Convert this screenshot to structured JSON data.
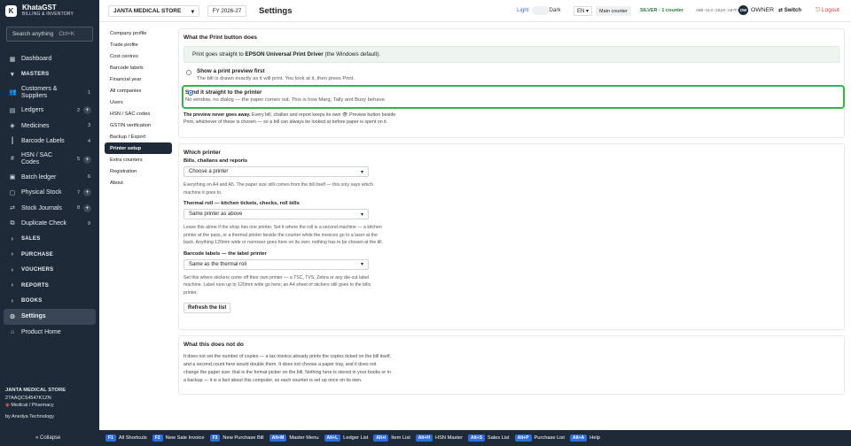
{
  "brand": {
    "logo": "K",
    "name": "KhataGST",
    "sub": "BILLING & INVENTORY"
  },
  "search": {
    "placeholder": "Search anything",
    "shortcut": "Ctrl+K"
  },
  "sidebar": {
    "items": [
      {
        "label": "Dashboard",
        "icon": "dashboard-icon"
      },
      {
        "label": "MASTERS"
      },
      {
        "label": "Customers & Suppliers",
        "count": "1"
      },
      {
        "label": "Ledgers",
        "count": "2"
      },
      {
        "label": "Medicines",
        "count": "3"
      },
      {
        "label": "Barcode Labels",
        "count": "4"
      },
      {
        "label": "HSN / SAC Codes",
        "count": "5"
      },
      {
        "label": "Batch ledger",
        "count": "6"
      },
      {
        "label": "Physical Stock",
        "count": "7"
      },
      {
        "label": "Stock Journals",
        "count": "8"
      },
      {
        "label": "Duplicate Check",
        "count": "9"
      },
      {
        "label": "SALES"
      },
      {
        "label": "PURCHASE"
      },
      {
        "label": "VOUCHERS"
      },
      {
        "label": "REPORTS"
      },
      {
        "label": "BOOKS"
      },
      {
        "label": "Settings"
      },
      {
        "label": "Product Home"
      }
    ],
    "footer": {
      "firm": "JANTA MEDICAL STORE",
      "gstin": "27AAQCS4547K1ZN",
      "type": "Medical / Pharmacy",
      "by": "by Anedya Technology",
      "collapse": "« Collapse"
    }
  },
  "topbar": {
    "shop": "JANTA MEDICAL STORE",
    "fy": "FY 2026-27",
    "title": "Settings",
    "light": "Light",
    "dark": "Dark",
    "lang": "EN",
    "counter": "Main counter",
    "plan": "SILVER · 1 counter",
    "key": "ANR-SLV-2026-A07F67",
    "user_initials": "OW",
    "user": "OWNER",
    "switch": "Switch",
    "logout": "Logout"
  },
  "subnav": [
    "Company profile",
    "Trade profile",
    "Cost centres",
    "Barcode labels",
    "Financial year",
    "All companies",
    "Users",
    "HSN / SAC codes",
    "GSTIN verification",
    "Backup / Export",
    "Printer setup",
    "Extra counters",
    "Registration",
    "About"
  ],
  "print_button": {
    "heading": "What the Print button does",
    "banner_pre": "Print goes straight to ",
    "banner_printer": "EPSON Universal Print Driver",
    "banner_post": " (the Windows default).",
    "option1_title": "Show a print preview first",
    "option1_sub": "The bill is drawn exactly as it will print. You look at it, then press Print.",
    "option2_title": "Send it straight to the printer",
    "option2_sub": "No window, no dialog — the paper comes out. This is how Marg, Tally and Busy behave.",
    "note_bold": "The preview never goes away.",
    "note_rest": " Every bill, challan and report keeps its own 👁 Preview button beside Print, whichever of these is chosen — so a bill can always be looked at before paper is spent on it."
  },
  "which_printer": {
    "heading": "Which printer",
    "bills_label": "Bills, challans and reports",
    "bills_value": "Choose a printer",
    "bills_help": "Everything on A4 and A5. The paper size still comes from the bill itself — this only says which machine it goes to.",
    "thermal_label": "Thermal roll — kitchen tickets, checks, roll bills",
    "thermal_value": "Same printer as above",
    "thermal_help": "Leave this alone if the shop has one printer. Set it where the roll is a second machine — a kitchen printer at the pass, or a thermal printer beside the counter while the invoices go to a laser at the back. Anything 120mm wide or narrower goes here on its own; nothing has to be chosen at the till.",
    "barcode_label": "Barcode labels — the label printer",
    "barcode_value": "Same as the thermal roll",
    "barcode_help": "Set this where stickers come off their own printer — a TSC, TVS, Zebra or any die-cut label machine. Label runs up to 120mm wide go here; an A4 sheet of stickers still goes to the bills printer.",
    "refresh": "Refresh the list"
  },
  "not_do": {
    "heading": "What this does not do",
    "text": "It does not set the number of copies — a tax invoice already prints the copies ticked on the bill itself, and a second count here would double them. It does not choose a paper tray, and it does not change the paper size: that is the format picker on the bill. Nothing here is stored in your books or in a backup — it is a fact about this computer, so each counter is set up once on its own."
  },
  "shortcuts": [
    {
      "key": "F1",
      "label": "All Shortcuts"
    },
    {
      "key": "F2",
      "label": "New Sale Invoice"
    },
    {
      "key": "F3",
      "label": "New Purchase Bill"
    },
    {
      "key": "Alt+M",
      "label": "Master Menu"
    },
    {
      "key": "Alt+L",
      "label": "Ledger List"
    },
    {
      "key": "Alt+I",
      "label": "Item List"
    },
    {
      "key": "Alt+H",
      "label": "HSN Master"
    },
    {
      "key": "Alt+S",
      "label": "Sales List"
    },
    {
      "key": "Alt+P",
      "label": "Purchase List"
    },
    {
      "key": "Alt+A",
      "label": "Help"
    }
  ]
}
